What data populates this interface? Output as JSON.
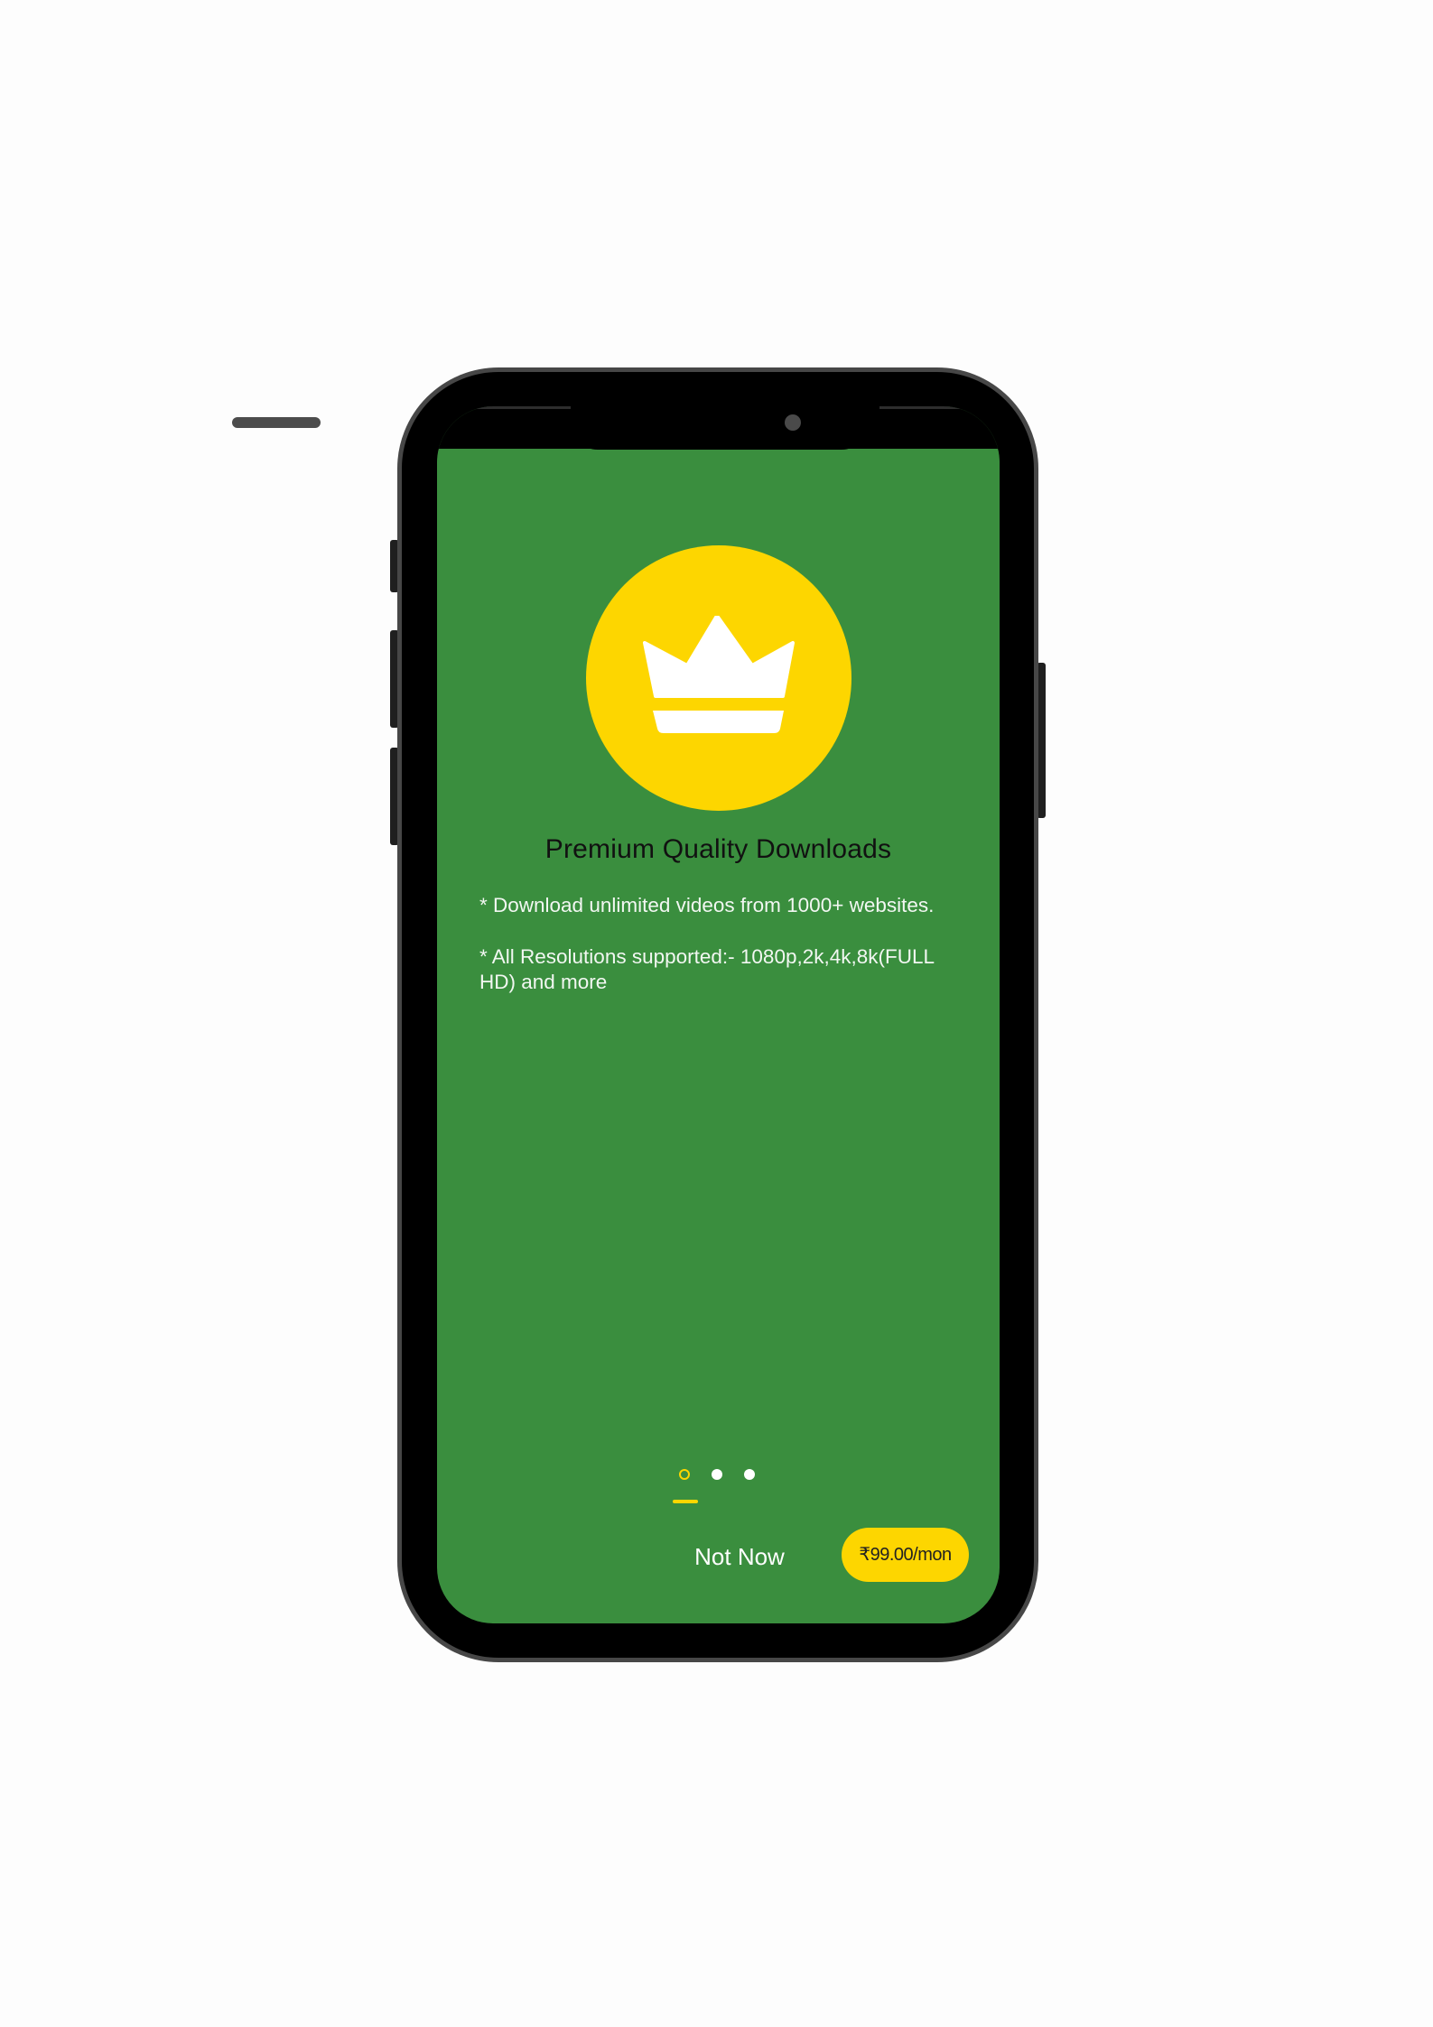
{
  "onboarding": {
    "title": "Premium Quality Downloads",
    "features": [
      "* Download unlimited videos from 1000+ websites.",
      "* All Resolutions supported:- 1080p,2k,4k,8k(FULL HD) and more"
    ],
    "icon": "crown-icon"
  },
  "pagination": {
    "total_pages": 3,
    "current_page": 1
  },
  "actions": {
    "dismiss_label": "Not Now",
    "subscribe_label": "₹99.00/mon"
  },
  "colors": {
    "background": "#3a8e3e",
    "accent": "#fdd600",
    "title_text": "#111111",
    "body_text": "#f2f7f2"
  }
}
